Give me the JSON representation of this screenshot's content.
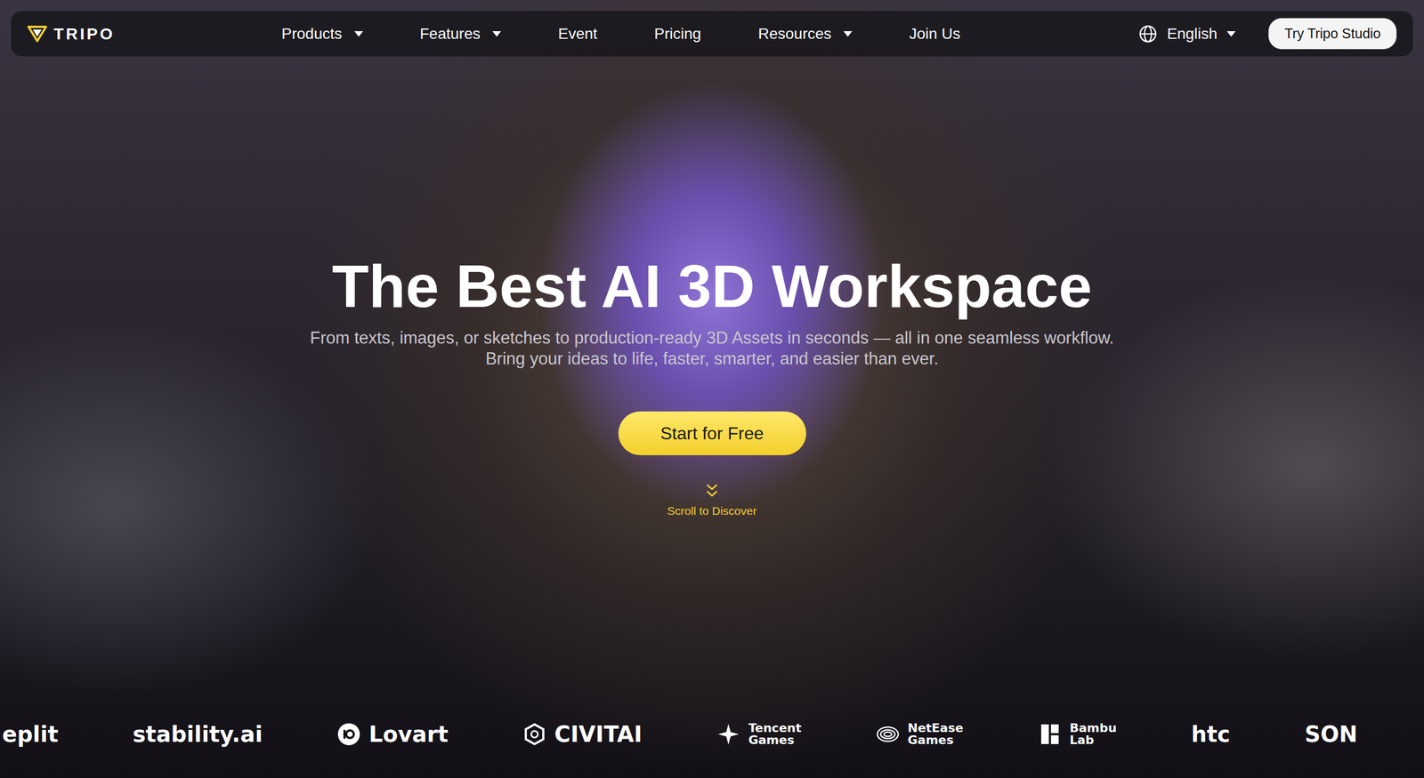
{
  "nav": {
    "brand": "TRIPO",
    "items": [
      {
        "label": "Products",
        "has_menu": true
      },
      {
        "label": "Features",
        "has_menu": true
      },
      {
        "label": "Event",
        "has_menu": false
      },
      {
        "label": "Pricing",
        "has_menu": false
      },
      {
        "label": "Resources",
        "has_menu": true
      },
      {
        "label": "Join Us",
        "has_menu": false
      }
    ],
    "language": {
      "label": "English",
      "has_menu": true
    },
    "cta": "Try Tripo Studio"
  },
  "hero": {
    "title": "The Best AI 3D Workspace",
    "subtitle": [
      "From texts, images, or sketches to production-ready 3D Assets in seconds — all in one seamless workflow.",
      "Bring your ideas to life, faster, smarter, and easier than ever."
    ],
    "button": "Start for Free",
    "scroll_hint": "Scroll to Discover"
  },
  "partners": [
    {
      "lines": [
        "eplit"
      ],
      "kind": "plain"
    },
    {
      "lines": [
        "stability.ai"
      ],
      "kind": "plain"
    },
    {
      "lines": [
        "Lovart"
      ],
      "kind": "circle-mark"
    },
    {
      "lines": [
        "CIVITAI"
      ],
      "kind": "hex-mark"
    },
    {
      "lines": [
        "Tencent",
        "Games"
      ],
      "kind": "star-mark"
    },
    {
      "lines": [
        "NetEase",
        "Games"
      ],
      "kind": "swirl-mark"
    },
    {
      "lines": [
        "Bambu",
        "Lab"
      ],
      "kind": "block-mark"
    },
    {
      "lines": [
        "htc"
      ],
      "kind": "plain"
    },
    {
      "lines": [
        "SON"
      ],
      "kind": "plain"
    }
  ]
}
